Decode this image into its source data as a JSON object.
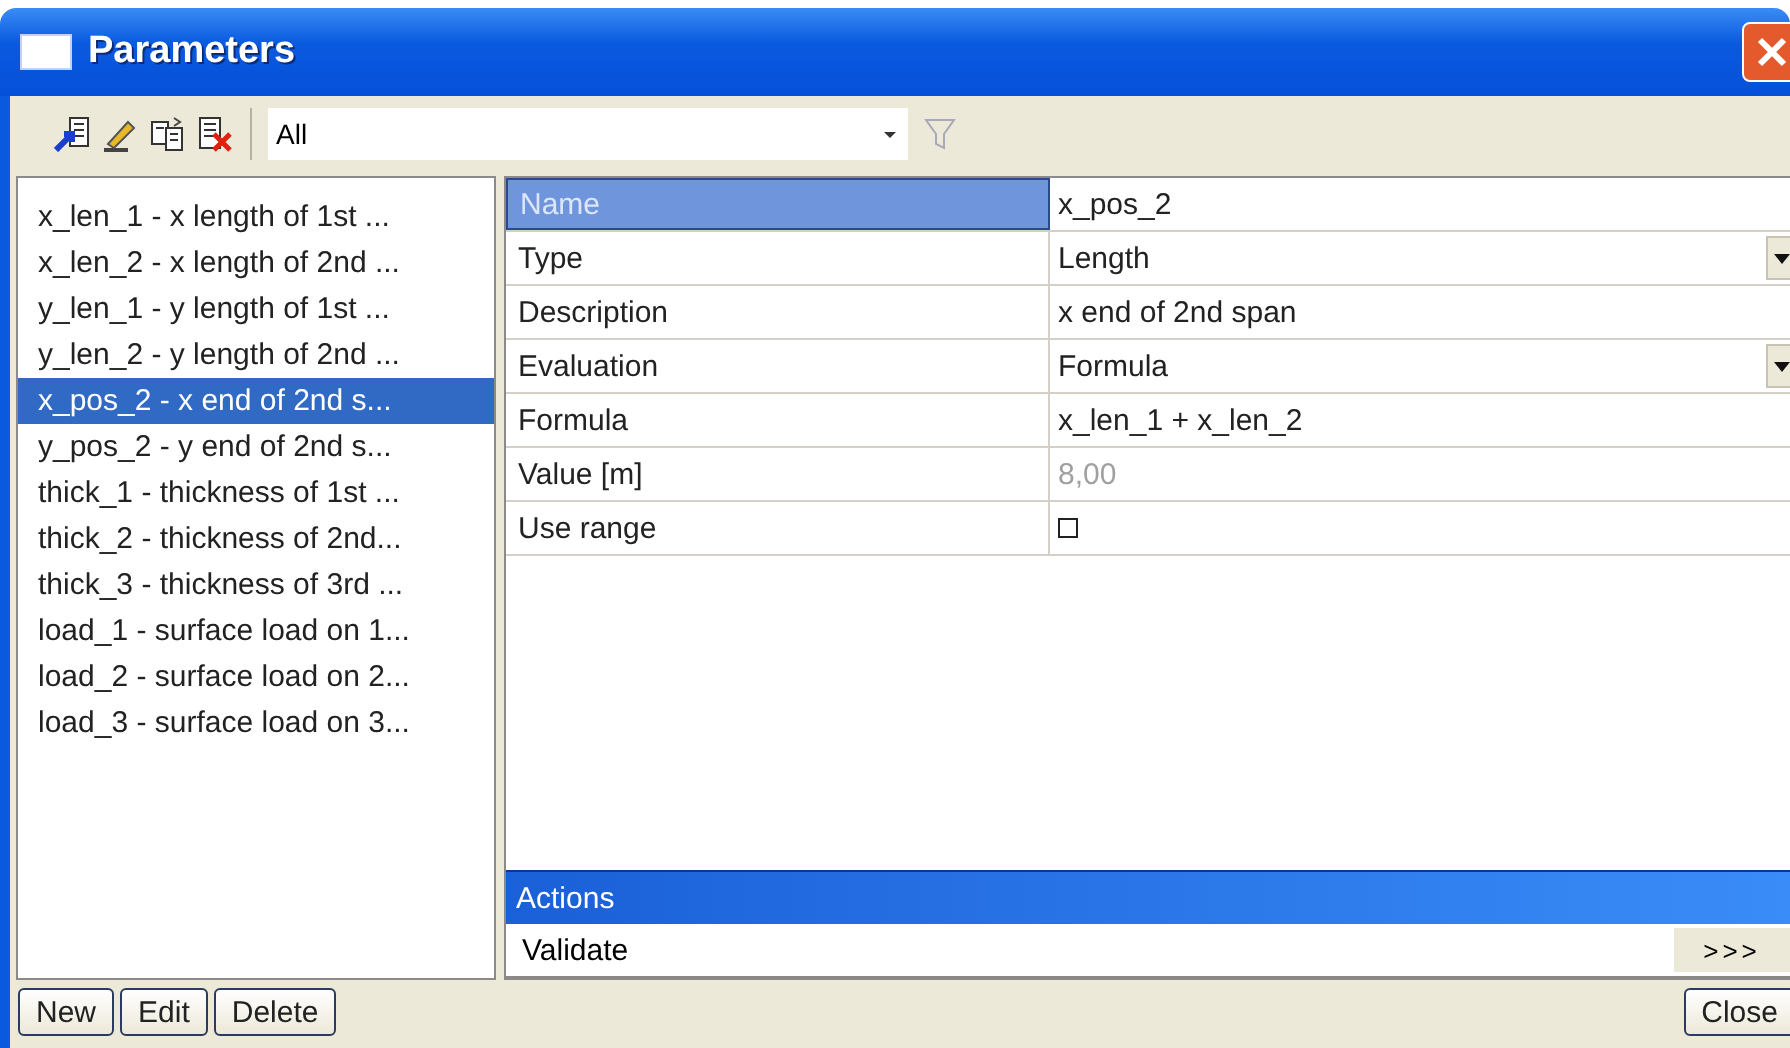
{
  "window": {
    "title": "Parameters"
  },
  "toolbar": {
    "filter": {
      "value": "All"
    }
  },
  "parameters": [
    {
      "label": "x_len_1 - x length of 1st ...",
      "selected": false
    },
    {
      "label": "x_len_2 - x length of 2nd ...",
      "selected": false
    },
    {
      "label": "y_len_1 - y length of 1st ...",
      "selected": false
    },
    {
      "label": "y_len_2 - y length of 2nd ...",
      "selected": false
    },
    {
      "label": "x_pos_2 - x end of 2nd s...",
      "selected": true
    },
    {
      "label": "y_pos_2 - y end of 2nd s...",
      "selected": false
    },
    {
      "label": "thick_1 - thickness of 1st ...",
      "selected": false
    },
    {
      "label": "thick_2 - thickness of 2nd...",
      "selected": false
    },
    {
      "label": "thick_3 - thickness of 3rd ...",
      "selected": false
    },
    {
      "label": "load_1 - surface load on 1...",
      "selected": false
    },
    {
      "label": "load_2 - surface load on 2...",
      "selected": false
    },
    {
      "label": "load_3 - surface load on 3...",
      "selected": false
    }
  ],
  "properties": [
    {
      "name": "Name",
      "value": "x_pos_2",
      "kind": "text",
      "selected": true
    },
    {
      "name": "Type",
      "value": "Length",
      "kind": "dropdown",
      "selected": false
    },
    {
      "name": "Description",
      "value": "x end of 2nd span",
      "kind": "text",
      "selected": false
    },
    {
      "name": "Evaluation",
      "value": "Formula",
      "kind": "dropdown",
      "selected": false
    },
    {
      "name": "Formula",
      "value": "x_len_1 + x_len_2",
      "kind": "text",
      "selected": false
    },
    {
      "name": "Value [m]",
      "value": "8,00",
      "kind": "readonly",
      "selected": false
    },
    {
      "name": "Use range",
      "kind": "checkbox",
      "checked": false,
      "selected": false
    }
  ],
  "actions": {
    "title": "Actions",
    "items": [
      {
        "label": "Validate",
        "button": ">>>"
      }
    ]
  },
  "buttons": [
    {
      "label": "New"
    },
    {
      "label": "Edit"
    },
    {
      "label": "Delete"
    }
  ],
  "close_button": {
    "label": "Close"
  }
}
